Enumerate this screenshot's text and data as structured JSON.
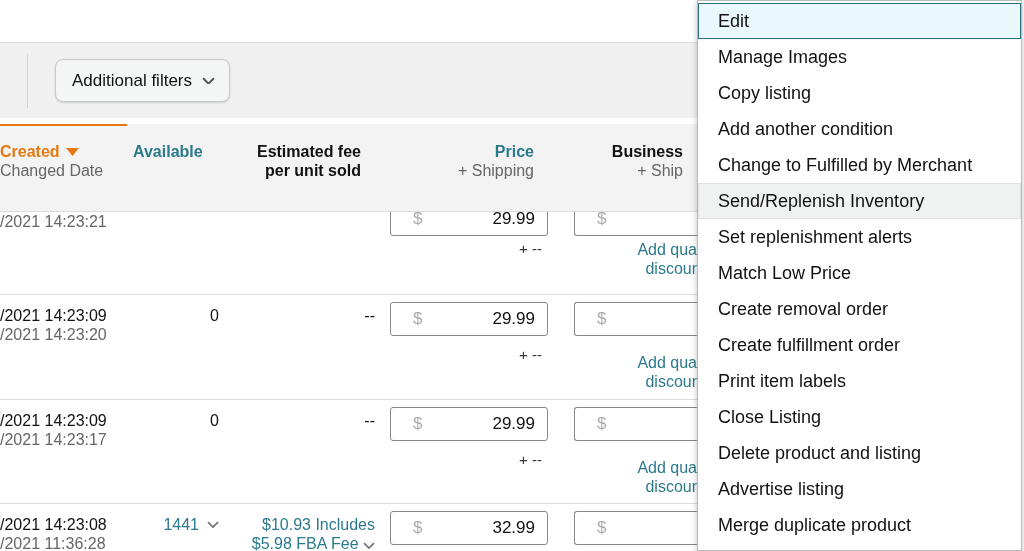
{
  "filters": {
    "button": "Additional filters"
  },
  "table": {
    "columns": [
      {
        "title": "Created",
        "subtitle": "Changed Date",
        "sorted": true,
        "link": false
      },
      {
        "title": "Available",
        "sorted": false,
        "link": true
      },
      {
        "title": "Estimated fee",
        "subtitle": "per unit sold",
        "sorted": false,
        "link": false
      },
      {
        "title": "Price",
        "subtitle": "+ Shipping",
        "sorted": false,
        "link": true
      },
      {
        "title": "Business",
        "subtitle": "+ Ship",
        "sorted": false,
        "link": false
      }
    ],
    "rows": [
      {
        "changed": "/2021 14:23:21",
        "price": "29.99",
        "currency": "$",
        "business_currency": "$",
        "shipping": "+ --",
        "discount": [
          "Add qua",
          "discour"
        ]
      },
      {
        "created": "/2021 14:23:09",
        "changed": "/2021 14:23:20",
        "available": {
          "text": "0",
          "link": false
        },
        "fee": {
          "text": "--",
          "link": false
        },
        "price": "29.99",
        "currency": "$",
        "business_currency": "$",
        "shipping": "+ --",
        "discount": [
          "Add qua",
          "discour"
        ]
      },
      {
        "created": "/2021 14:23:09",
        "changed": "/2021 14:23:17",
        "available": {
          "text": "0",
          "link": false
        },
        "fee": {
          "text": "--",
          "link": false
        },
        "price": "29.99",
        "currency": "$",
        "business_currency": "$",
        "shipping": "+ --",
        "discount": [
          "Add qua",
          "discour"
        ]
      },
      {
        "created": "/2021 14:23:08",
        "changed": "/2021 11:36:28",
        "available": {
          "text": "1441",
          "link": true
        },
        "fee": {
          "text": "$10.93 Includes $5.98 FBA Fee",
          "link": true
        },
        "price": "32.99",
        "currency": "$",
        "business_currency": "$"
      }
    ]
  },
  "menu": {
    "items": [
      {
        "label": "Edit",
        "selected": true,
        "hovered": false
      },
      {
        "label": "Manage Images",
        "selected": false,
        "hovered": false
      },
      {
        "label": "Copy listing",
        "selected": false,
        "hovered": false
      },
      {
        "label": "Add another condition",
        "selected": false,
        "hovered": false
      },
      {
        "label": "Change to Fulfilled by Merchant",
        "selected": false,
        "hovered": false
      },
      {
        "label": "Send/Replenish Inventory",
        "selected": false,
        "hovered": true
      },
      {
        "label": "Set replenishment alerts",
        "selected": false,
        "hovered": false
      },
      {
        "label": "Match Low Price",
        "selected": false,
        "hovered": false
      },
      {
        "label": "Create removal order",
        "selected": false,
        "hovered": false
      },
      {
        "label": "Create fulfillment order",
        "selected": false,
        "hovered": false
      },
      {
        "label": "Print item labels",
        "selected": false,
        "hovered": false
      },
      {
        "label": "Close Listing",
        "selected": false,
        "hovered": false
      },
      {
        "label": "Delete product and listing",
        "selected": false,
        "hovered": false
      },
      {
        "label": "Advertise listing",
        "selected": false,
        "hovered": false
      },
      {
        "label": "Merge duplicate product",
        "selected": false,
        "hovered": false
      }
    ]
  }
}
